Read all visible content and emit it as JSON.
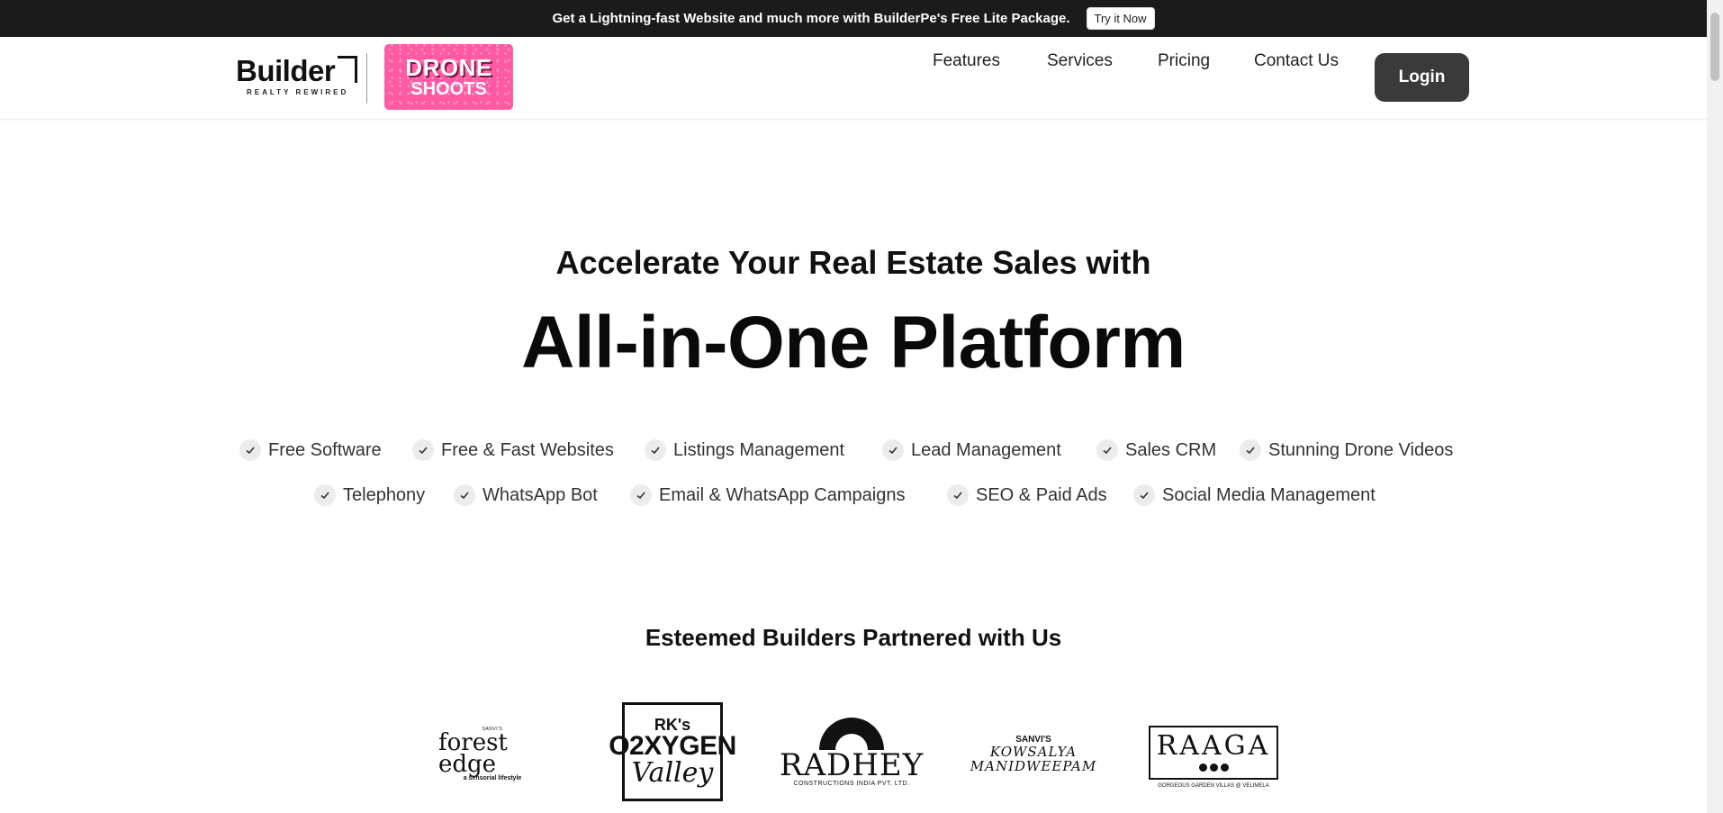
{
  "announcement": {
    "text": "Get a Lightning-fast Website and much more with BuilderPe's Free Lite Package.",
    "cta_label": "Try it Now"
  },
  "header": {
    "logo_text": "Builder",
    "logo_tagline": "REALTY REWIRED",
    "badge_line1": "DRONE",
    "badge_line2": "SHOOTS",
    "nav": [
      "Features",
      "Services",
      "Pricing",
      "Contact Us"
    ],
    "login_label": "Login"
  },
  "hero": {
    "subtitle": "Accelerate Your Real Estate Sales with",
    "title": "All-in-One Platform",
    "features_row1": [
      "Free Software",
      "Free & Fast Websites",
      "Listings Management",
      "Lead Management",
      "Sales CRM",
      "Stunning Drone Videos"
    ],
    "features_row2": [
      "Telephony",
      "WhatsApp Bot",
      "Email & WhatsApp Campaigns",
      "SEO & Paid Ads",
      "Social Media Management"
    ]
  },
  "partners": {
    "title": "Esteemed Builders Partnered with Us",
    "logos": {
      "forest_small": "SANVI'S",
      "forest_main": "forest edge",
      "forest_sub": "a sensorial lifestyle",
      "oxygen_top": "RK's",
      "oxygen_main": "O2XYGEN",
      "oxygen_bottom": "Valley",
      "radhey_main": "RADHEY",
      "radhey_sub": "CONSTRUCTIONS INDIA PVT. LTD.",
      "kowsalya_small": "SANVI'S",
      "kowsalya_line1": "KOWSALYA",
      "kowsalya_line2": "MANIDWEEPAM",
      "raaga_main": "RAAGA",
      "raaga_sub": "GORGEOUS GARDEN VILLAS @ VELIMELA"
    }
  },
  "colors": {
    "topbar": "#1b1b1b",
    "login_button": "#3a3a3a",
    "drone_badge": "#ff5aa3"
  }
}
